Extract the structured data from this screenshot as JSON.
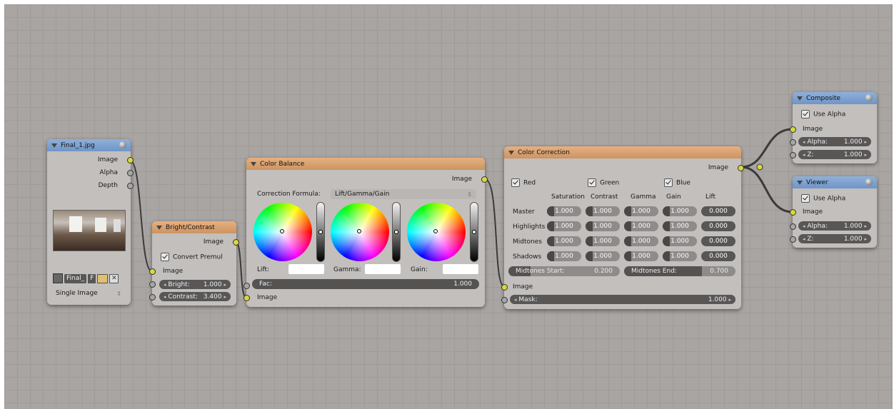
{
  "colors": {
    "input_header": "#7a9fcf",
    "op_header": "#d9a070",
    "socket_yellow": "#d8d83a",
    "socket_gray": "#a6a6a6"
  },
  "image_node": {
    "title": "Final_1.jpg",
    "outputs": [
      "Image",
      "Alpha",
      "Depth"
    ],
    "image_name": "Final_",
    "image_flag": "F",
    "source": "Single Image"
  },
  "bright_node": {
    "title": "Bright/Contrast",
    "output": "Image",
    "convert_premul": "Convert Premul",
    "input": "Image",
    "bright_label": "Bright:",
    "bright_value": "1.000",
    "contrast_label": "Contrast:",
    "contrast_value": "3.400"
  },
  "balance_node": {
    "title": "Color Balance",
    "output": "Image",
    "formula_label": "Correction Formula:",
    "formula_value": "Lift/Gamma/Gain",
    "lift": "Lift:",
    "gamma": "Gamma:",
    "gain": "Gain:",
    "fac_label": "Fac:",
    "fac_value": "1.000",
    "input": "Image"
  },
  "correction_node": {
    "title": "Color Correction",
    "output": "Image",
    "red": "Red",
    "green": "Green",
    "blue": "Blue",
    "columns": [
      "Saturation",
      "Contrast",
      "Gamma",
      "Gain",
      "Lift"
    ],
    "rows": [
      {
        "label": "Master",
        "values": [
          "1.000",
          "1.000",
          "1.000",
          "1.000",
          "0.000"
        ]
      },
      {
        "label": "Highlights",
        "values": [
          "1.000",
          "1.000",
          "1.000",
          "1.000",
          "0.000"
        ]
      },
      {
        "label": "Midtones",
        "values": [
          "1.000",
          "1.000",
          "1.000",
          "1.000",
          "0.000"
        ]
      },
      {
        "label": "Shadows",
        "values": [
          "1.000",
          "1.000",
          "1.000",
          "1.000",
          "0.000"
        ]
      }
    ],
    "mid_start_label": "Midtones Start:",
    "mid_start_value": "0.200",
    "mid_end_label": "Midtones End:",
    "mid_end_value": "0.700",
    "input": "Image",
    "mask_label": "Mask:",
    "mask_value": "1.000"
  },
  "composite_node": {
    "title": "Composite",
    "use_alpha": "Use Alpha",
    "input": "Image",
    "alpha_label": "Alpha:",
    "alpha_value": "1.000",
    "z_label": "Z:",
    "z_value": "1.000"
  },
  "viewer_node": {
    "title": "Viewer",
    "use_alpha": "Use Alpha",
    "input": "Image",
    "alpha_label": "Alpha:",
    "alpha_value": "1.000",
    "z_label": "Z:",
    "z_value": "1.000"
  }
}
